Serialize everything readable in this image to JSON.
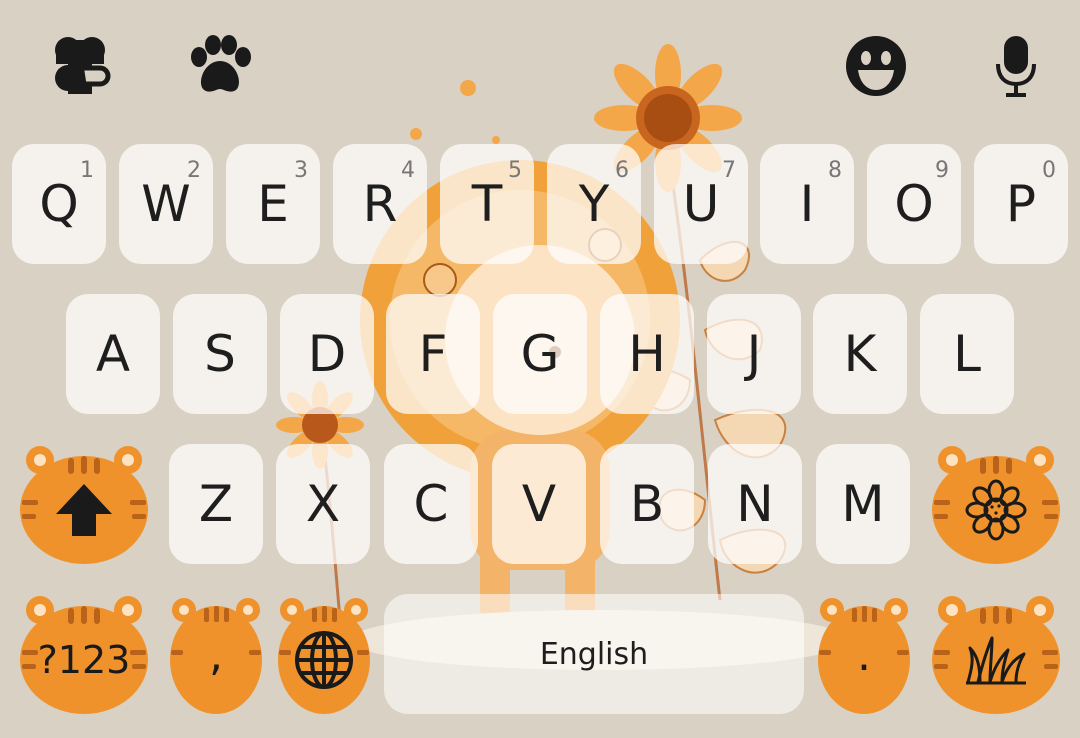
{
  "toolbar": {
    "left_icons": [
      "clover-icon",
      "paw-icon"
    ],
    "right_icons": [
      "emoji-icon",
      "microphone-icon"
    ]
  },
  "keyboard": {
    "row1": [
      {
        "label": "Q",
        "hint": "1"
      },
      {
        "label": "W",
        "hint": "2"
      },
      {
        "label": "E",
        "hint": "3"
      },
      {
        "label": "R",
        "hint": "4"
      },
      {
        "label": "T",
        "hint": "5"
      },
      {
        "label": "Y",
        "hint": "6"
      },
      {
        "label": "U",
        "hint": "7"
      },
      {
        "label": "I",
        "hint": "8"
      },
      {
        "label": "O",
        "hint": "9"
      },
      {
        "label": "P",
        "hint": "0"
      }
    ],
    "row2": [
      {
        "label": "A"
      },
      {
        "label": "S"
      },
      {
        "label": "D"
      },
      {
        "label": "F"
      },
      {
        "label": "G"
      },
      {
        "label": "H"
      },
      {
        "label": "J"
      },
      {
        "label": "K"
      },
      {
        "label": "L"
      }
    ],
    "row3": [
      {
        "label": "Z"
      },
      {
        "label": "X"
      },
      {
        "label": "C"
      },
      {
        "label": "V"
      },
      {
        "label": "B"
      },
      {
        "label": "N"
      },
      {
        "label": "M"
      }
    ],
    "shift_icon": "shift-arrow-icon",
    "delete_icon": "sunflower-icon",
    "symbols_label": "?123",
    "comma_label": ",",
    "globe_icon": "globe-icon",
    "space_label": "English",
    "period_label": ".",
    "enter_icon": "grass-icon"
  },
  "colors": {
    "background": "#d9d1c3",
    "key_face": "#f5f2ee",
    "tiger_orange": "#f0922b",
    "tiger_stripe": "#b8621a",
    "ink": "#1a1a1a"
  }
}
